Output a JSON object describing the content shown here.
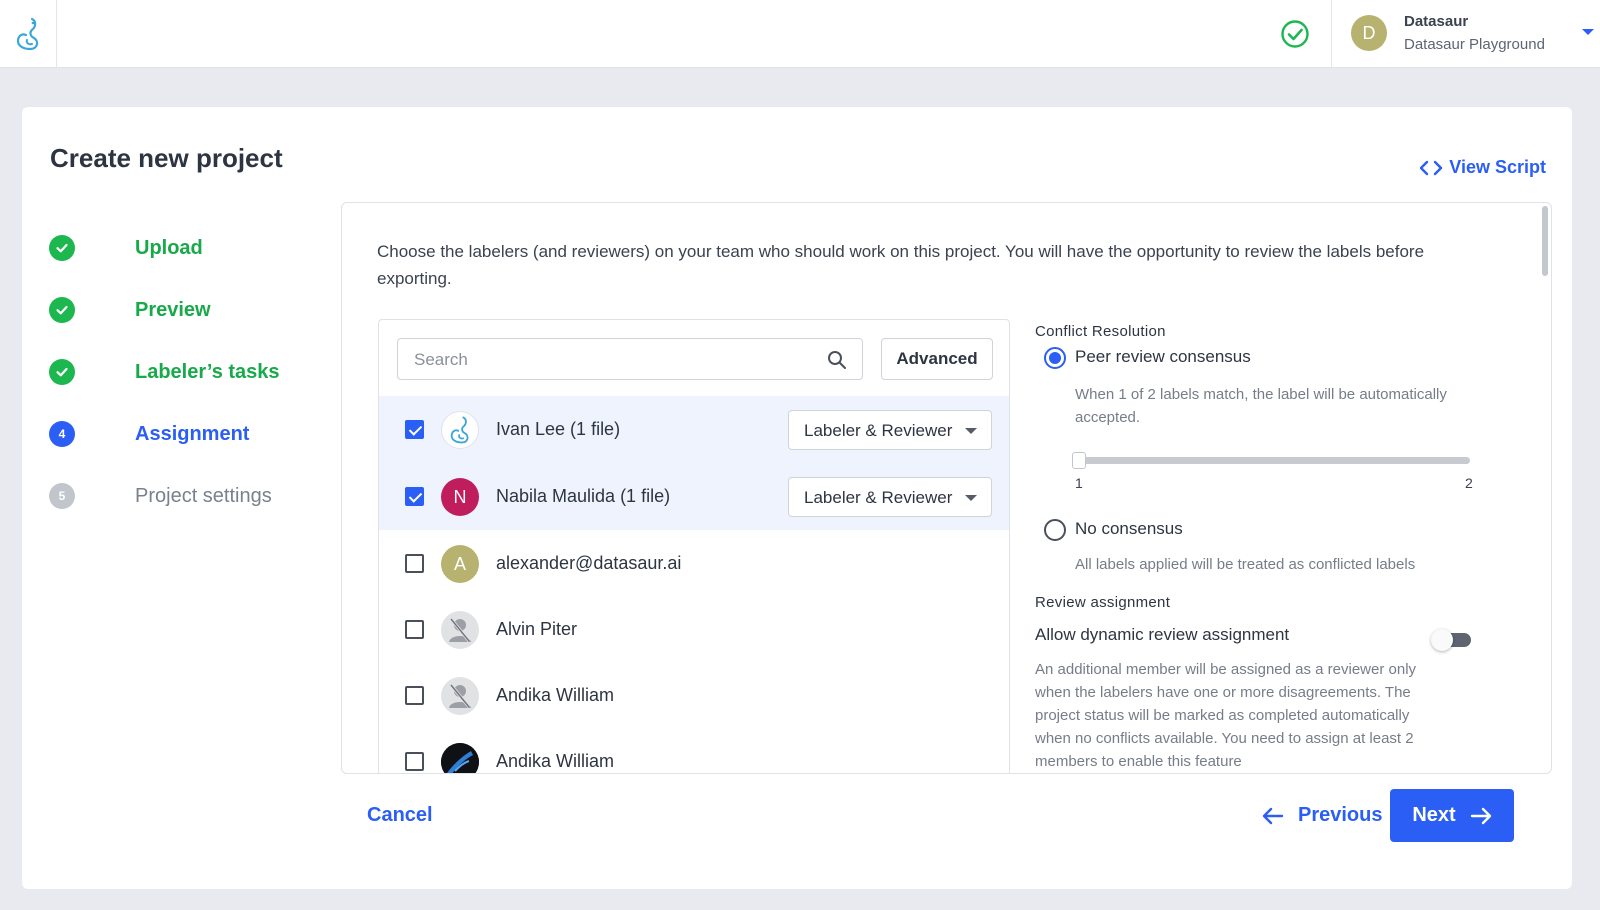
{
  "topbar": {
    "org_name": "Datasaur",
    "workspace": "Datasaur Playground",
    "avatar_initial": "D",
    "status_icon": "check-circle-icon",
    "dropdown_icon": "caret-down-icon"
  },
  "page": {
    "title": "Create new project",
    "view_script_label": "View Script"
  },
  "steps": [
    {
      "label": "Upload",
      "state": "done"
    },
    {
      "label": "Preview",
      "state": "done"
    },
    {
      "label": "Labeler’s tasks",
      "state": "done"
    },
    {
      "label": "Assignment",
      "state": "active",
      "number": "4"
    },
    {
      "label": "Project settings",
      "state": "todo",
      "number": "5"
    }
  ],
  "assignment": {
    "description": "Choose the labelers (and reviewers) on your team who should work on this project. You will have the opportunity to review the labels before exporting.",
    "search_placeholder": "Search",
    "advanced_label": "Advanced",
    "members": [
      {
        "name": "Ivan Lee (1 file)",
        "checked": true,
        "role": "Labeler & Reviewer",
        "avatar": "datasaur-logo"
      },
      {
        "name": "Nabila Maulida (1 file)",
        "checked": true,
        "role": "Labeler & Reviewer",
        "avatar_initial": "N"
      },
      {
        "name": "alexander@datasaur.ai",
        "checked": false,
        "avatar_initial": "A"
      },
      {
        "name": "Alvin Piter",
        "checked": false,
        "avatar": "placeholder-user-icon"
      },
      {
        "name": "Andika William",
        "checked": false,
        "avatar": "placeholder-user-icon"
      },
      {
        "name": "Andika William",
        "checked": false,
        "avatar": "photo"
      }
    ]
  },
  "conflict": {
    "section_title": "Conflict Resolution",
    "peer_label": "Peer review consensus",
    "peer_hint": "When 1 of 2 labels match, the label will be automatically accepted.",
    "slider_value": 1,
    "slider_min": "1",
    "slider_max": "2",
    "no_consensus_label": "No consensus",
    "no_consensus_hint": "All labels applied will be treated as conflicted labels",
    "selected": "peer"
  },
  "review": {
    "section_title": "Review assignment",
    "toggle_label": "Allow dynamic review assignment",
    "toggle_on": false,
    "hint": "An additional member will be assigned as a reviewer only when the labelers have one or more disagreements. The project status will be marked as completed automatically when no conflicts available. You need to assign at least 2 members to enable this feature"
  },
  "footer": {
    "cancel_label": "Cancel",
    "previous_label": "Previous",
    "next_label": "Next"
  },
  "colors": {
    "accent": "#2a5ef5",
    "success": "#1cb84f",
    "background": "#e8eaef"
  }
}
